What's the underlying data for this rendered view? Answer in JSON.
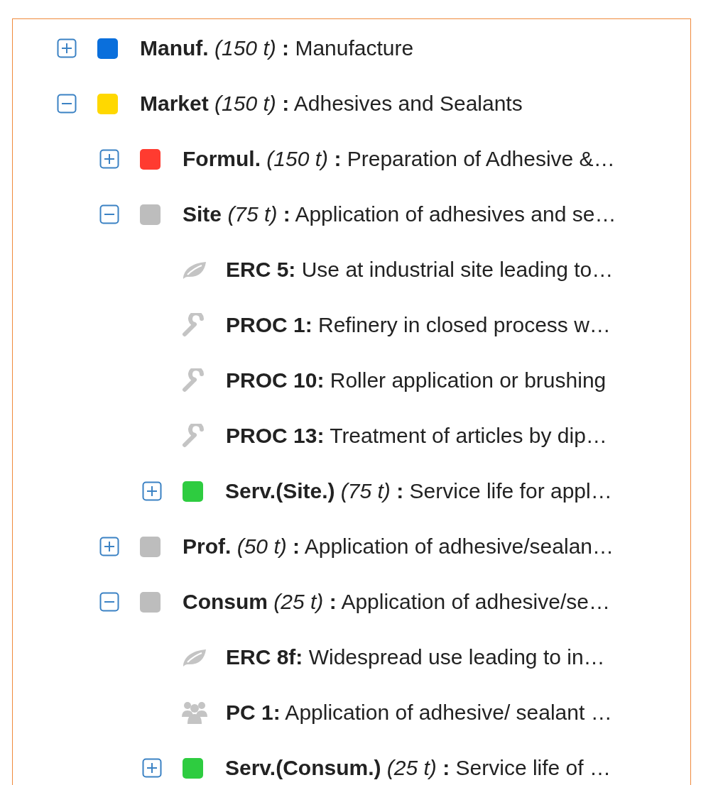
{
  "tree": [
    {
      "kind": "group",
      "expanded": false,
      "color": "#0a6fdc",
      "label": "**Manuf.** *(150 t)* **:** Manufacture"
    },
    {
      "kind": "group",
      "expanded": true,
      "color": "#ffd800",
      "label": "**Market** *(150 t)* **:** Adhesives and Sealants",
      "children": [
        {
          "kind": "group",
          "expanded": false,
          "color": "#ff3b30",
          "label": "**Formul.** *(150 t)* **:** Preparation of Adhesive &…"
        },
        {
          "kind": "group",
          "expanded": true,
          "color": "#bdbdbd",
          "label": "**Site** *(75 t)* **:** Application of adhesives and se…",
          "children": [
            {
              "kind": "erc",
              "label": "**ERC 5:** Use at industrial site leading to…"
            },
            {
              "kind": "proc",
              "label": "**PROC 1:** Refinery in closed process w…"
            },
            {
              "kind": "proc",
              "label": "**PROC 10:** Roller application or brushing"
            },
            {
              "kind": "proc",
              "label": "**PROC 13:** Treatment of articles by dip…"
            },
            {
              "kind": "group",
              "expanded": false,
              "color": "#2ecc40",
              "label": "**Serv.(Site.)** *(75 t)* **:** Service life for appl…"
            }
          ]
        },
        {
          "kind": "group",
          "expanded": false,
          "color": "#bdbdbd",
          "label": "**Prof.** *(50 t)* **:** Application of adhesive/sealan…"
        },
        {
          "kind": "group",
          "expanded": true,
          "color": "#bdbdbd",
          "label": "**Consum** *(25 t)* **:** Application of adhesive/se…",
          "children": [
            {
              "kind": "erc",
              "label": "**ERC 8f:** Widespread use leading to in…"
            },
            {
              "kind": "pc",
              "label": "**PC 1:** Application of adhesive/ sealant …"
            },
            {
              "kind": "group",
              "expanded": false,
              "color": "#2ecc40",
              "label": "**Serv.(Consum.)** *(25 t)* **:** Service life of …"
            }
          ]
        }
      ]
    }
  ]
}
